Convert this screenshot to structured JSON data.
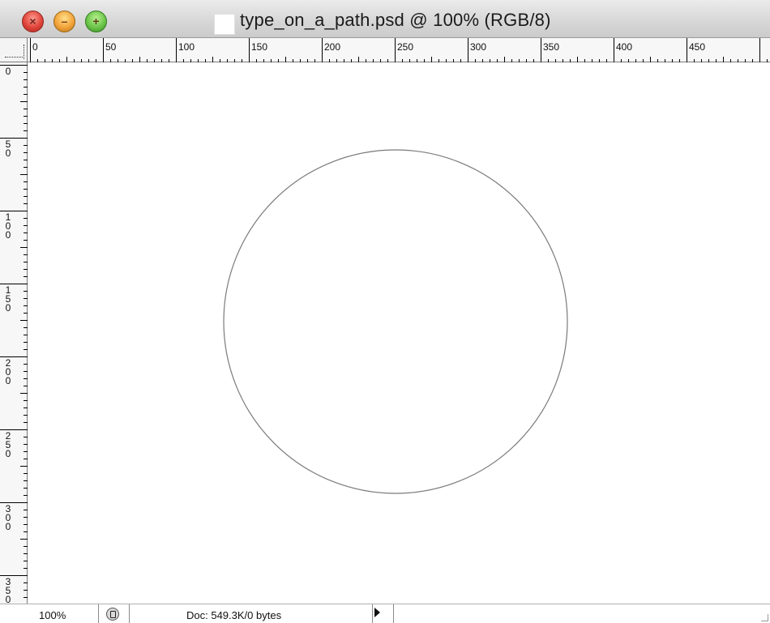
{
  "window": {
    "title": "type_on_a_path.psd @ 100% (RGB/8)"
  },
  "ruler_top": {
    "labels": [
      "0",
      "50",
      "100",
      "150",
      "200",
      "250",
      "300",
      "350",
      "400",
      "450"
    ]
  },
  "ruler_left": {
    "labels": [
      "0",
      "50",
      "100",
      "150",
      "200",
      "250",
      "300",
      "350"
    ]
  },
  "status": {
    "zoom": "100%",
    "doc_info": "Doc: 549.3K/0 bytes"
  },
  "colors": {
    "circle_path": "#7a7a7a",
    "close": "#e0443a",
    "minimize": "#f2a33a",
    "zoom": "#6cc54a"
  }
}
